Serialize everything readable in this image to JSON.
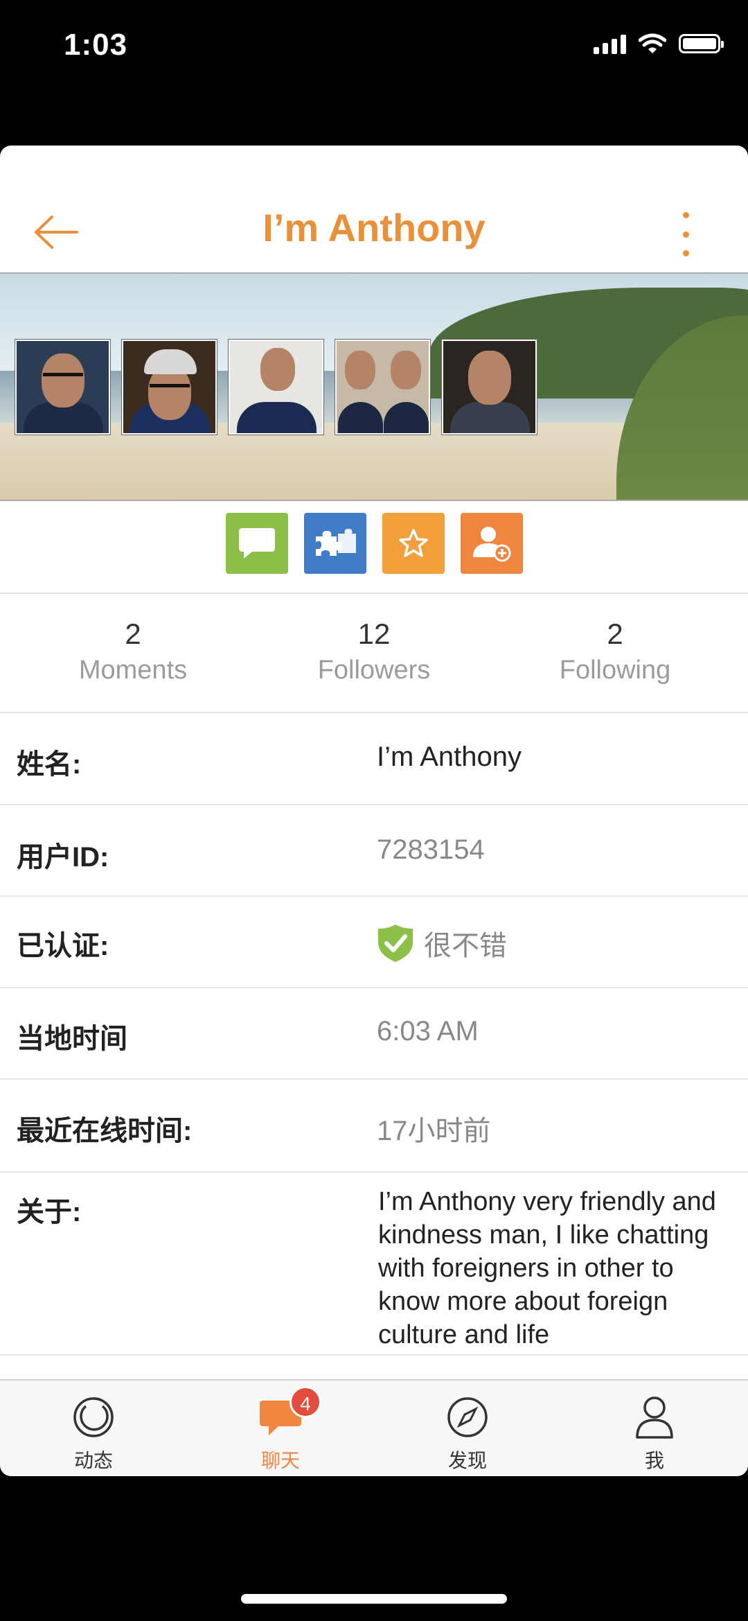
{
  "status_bar": {
    "time": "1:03"
  },
  "header": {
    "title": "I’m Anthony"
  },
  "stats": [
    {
      "value": "2",
      "label": "Moments"
    },
    {
      "value": "12",
      "label": "Followers"
    },
    {
      "value": "2",
      "label": "Following"
    }
  ],
  "info": {
    "name": {
      "label": "姓名:",
      "value": "I’m Anthony"
    },
    "user_id": {
      "label": "用户ID:",
      "value": "7283154"
    },
    "verified": {
      "label": "已认证:",
      "value": "很不错"
    },
    "local_time": {
      "label": "当地时间",
      "value": "6:03 AM"
    },
    "last_online": {
      "label": "最近在线时间:",
      "value": "17小时前"
    },
    "about": {
      "label": "关于:",
      "value": "I’m Anthony very friendly and kindness man, I like chatting with foreigners in other to know more about foreign culture and life"
    }
  },
  "tabbar": {
    "items": [
      {
        "label": "动态",
        "icon": "moments-icon"
      },
      {
        "label": "聊天",
        "icon": "chat-icon",
        "badge": "4"
      },
      {
        "label": "发现",
        "icon": "compass-icon"
      },
      {
        "label": "我",
        "icon": "person-icon"
      }
    ],
    "active_index": 1
  },
  "colors": {
    "accent": "#E8913A",
    "chat_button": "#8CC049",
    "puzzle_button": "#3F7DC8",
    "star_button": "#F2A03C",
    "add_friend_button": "#EE8640",
    "verified_badge": "#8CC049",
    "badge": "#E24C3C"
  }
}
